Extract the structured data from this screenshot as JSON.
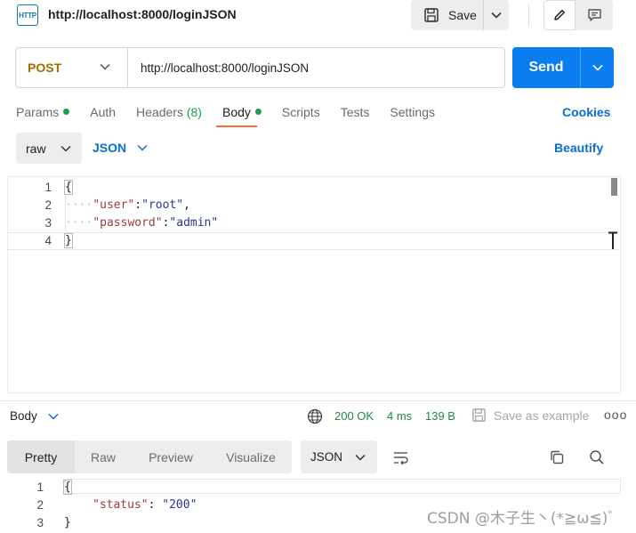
{
  "topbar": {
    "http_icon_text": "HTTP",
    "title": "http://localhost:8000/loginJSON",
    "save_label": "Save",
    "icons": [
      "http-icon",
      "save-icon",
      "chevron-down-icon",
      "pencil-icon",
      "comment-icon"
    ]
  },
  "request": {
    "method": "POST",
    "url": "http://localhost:8000/loginJSON",
    "send_label": "Send"
  },
  "tabs": {
    "params": "Params",
    "auth": "Auth",
    "headers": "Headers",
    "headers_count": "(8)",
    "body": "Body",
    "scripts": "Scripts",
    "tests": "Tests",
    "settings": "Settings",
    "cookies": "Cookies",
    "active": "Body"
  },
  "body_mode": {
    "raw": "raw",
    "format": "JSON",
    "beautify": "Beautify"
  },
  "editor": {
    "line_numbers": [
      "1",
      "2",
      "3",
      "4"
    ],
    "line1": "{",
    "line2_key": "\"user\"",
    "line2_sep": ":",
    "line2_val": "\"root\"",
    "line2_end": ",",
    "line3_key": "\"password\"",
    "line3_sep": ":",
    "line3_val": "\"admin\"",
    "line4": "}",
    "indent_dots": "····"
  },
  "response": {
    "body_label": "Body",
    "status": "200 OK",
    "time": "4 ms",
    "size": "139 B",
    "save_example": "Save as example",
    "more": "ooo",
    "views": [
      "Pretty",
      "Raw",
      "Preview",
      "Visualize"
    ],
    "active_view": "Pretty",
    "format": "JSON",
    "line_numbers": [
      "1",
      "2",
      "3"
    ],
    "line1": "{",
    "line2_key": "\"status\"",
    "line2_sep": ": ",
    "line2_val": "\"200\"",
    "line3": "}"
  },
  "watermark": "CSDN @木子生丶(*≧ω≦)ﾞ",
  "colors": {
    "send": "#0a7ef0",
    "method": "#a06b00",
    "accent_tab": "#ff6c37",
    "link": "#0a6ed1",
    "success": "#1e8a3e"
  }
}
